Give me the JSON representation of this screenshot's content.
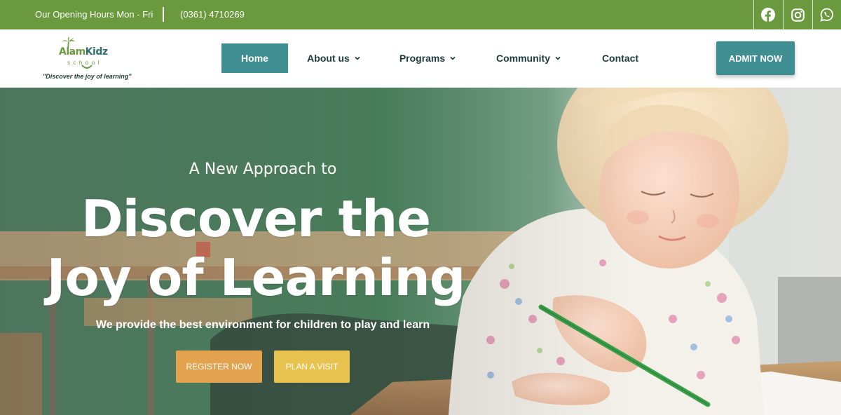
{
  "topbar": {
    "hours": "Our Opening Hours Mon - Fri",
    "phone": "(0361) 4710269",
    "social": [
      "facebook-icon",
      "instagram-icon",
      "whatsapp-icon"
    ],
    "background": "#6b9a3e"
  },
  "logo": {
    "brand_part1": "Alam",
    "brand_part2": "Kidz",
    "school": "school",
    "tagline": "\"Discover the joy of learning\""
  },
  "nav": {
    "items": [
      {
        "label": "Home",
        "active": true,
        "dropdown": false
      },
      {
        "label": "About us",
        "active": false,
        "dropdown": true
      },
      {
        "label": "Programs",
        "active": false,
        "dropdown": true
      },
      {
        "label": "Community",
        "active": false,
        "dropdown": true
      },
      {
        "label": "Contact",
        "active": false,
        "dropdown": false
      }
    ],
    "cta": "ADMIT NOW",
    "accent": "#3f8e92"
  },
  "hero": {
    "kicker": "A New Approach to",
    "headline_line1": "Discover the",
    "headline_line2": "Joy of Learning",
    "subtitle": "We provide the best environment for children to play and learn",
    "buttons": {
      "register": "REGISTER NOW",
      "visit": "PLAN A VISIT"
    },
    "colors": {
      "register": "#e2a24e",
      "visit": "#e8c24e"
    }
  }
}
